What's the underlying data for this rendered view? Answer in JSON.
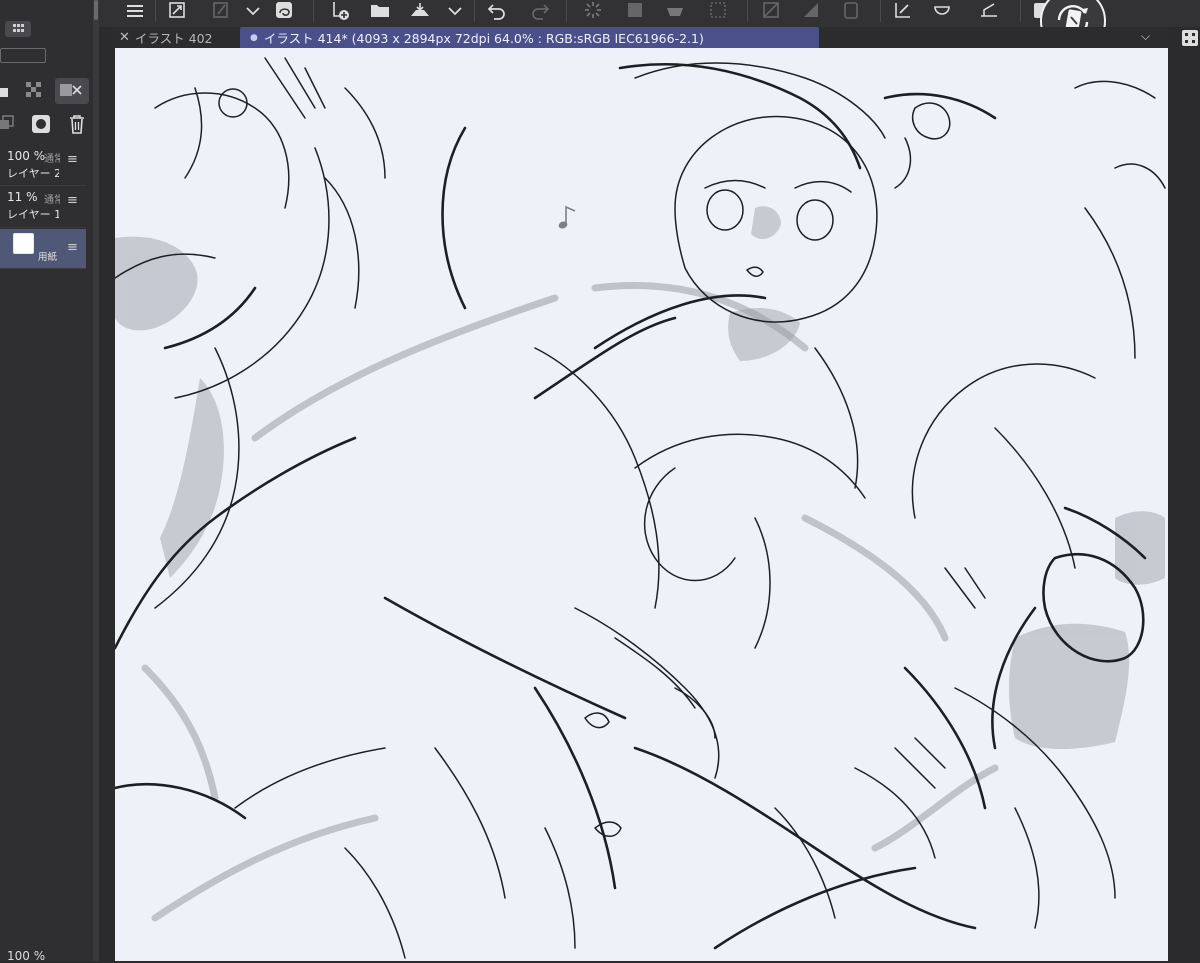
{
  "tabs": [
    {
      "label": "イラスト 402",
      "close_glyph": "✕",
      "active": false
    },
    {
      "label": "イラスト 414* (4093 x 2894px 72dpi 64.0% : RGB:sRGB IEC61966-2.1)",
      "dot_glyph": "●",
      "active": true
    }
  ],
  "toolbar": {
    "icons": [
      "menu-icon",
      "fit-icon",
      "chevron-down-icon",
      "pen-icon",
      "chevron-down-icon",
      "lasso-icon",
      "new-layer-icon",
      "open-folder-icon",
      "export-icon",
      "chevron-down-icon",
      "undo-icon",
      "redo-icon",
      "loading-icon",
      "select-icon",
      "eraser-icon",
      "transform-icon",
      "gradient-icon",
      "clip-icon",
      "ruler-icon",
      "fill-icon",
      "adjust-icon",
      "canvas-rotate-icon"
    ]
  },
  "layers": [
    {
      "opacity": "100 %",
      "mode": "通常",
      "name": "レイヤー 2"
    },
    {
      "opacity": "11 %",
      "mode": "通常",
      "name": "レイヤー 1"
    },
    {
      "opacity": "",
      "mode": "",
      "name": "用紙",
      "selected": true
    }
  ],
  "layer_menu_glyph": "≡",
  "bottom_opacity": "100 %",
  "tab_overflow_glyph": "⌵",
  "colors": {
    "canvas": "#eef2f8",
    "active_tab": "#49508a",
    "selected_layer": "#4f5877",
    "sketch_line": "#1e1f23",
    "wash": "#b7bac2"
  }
}
